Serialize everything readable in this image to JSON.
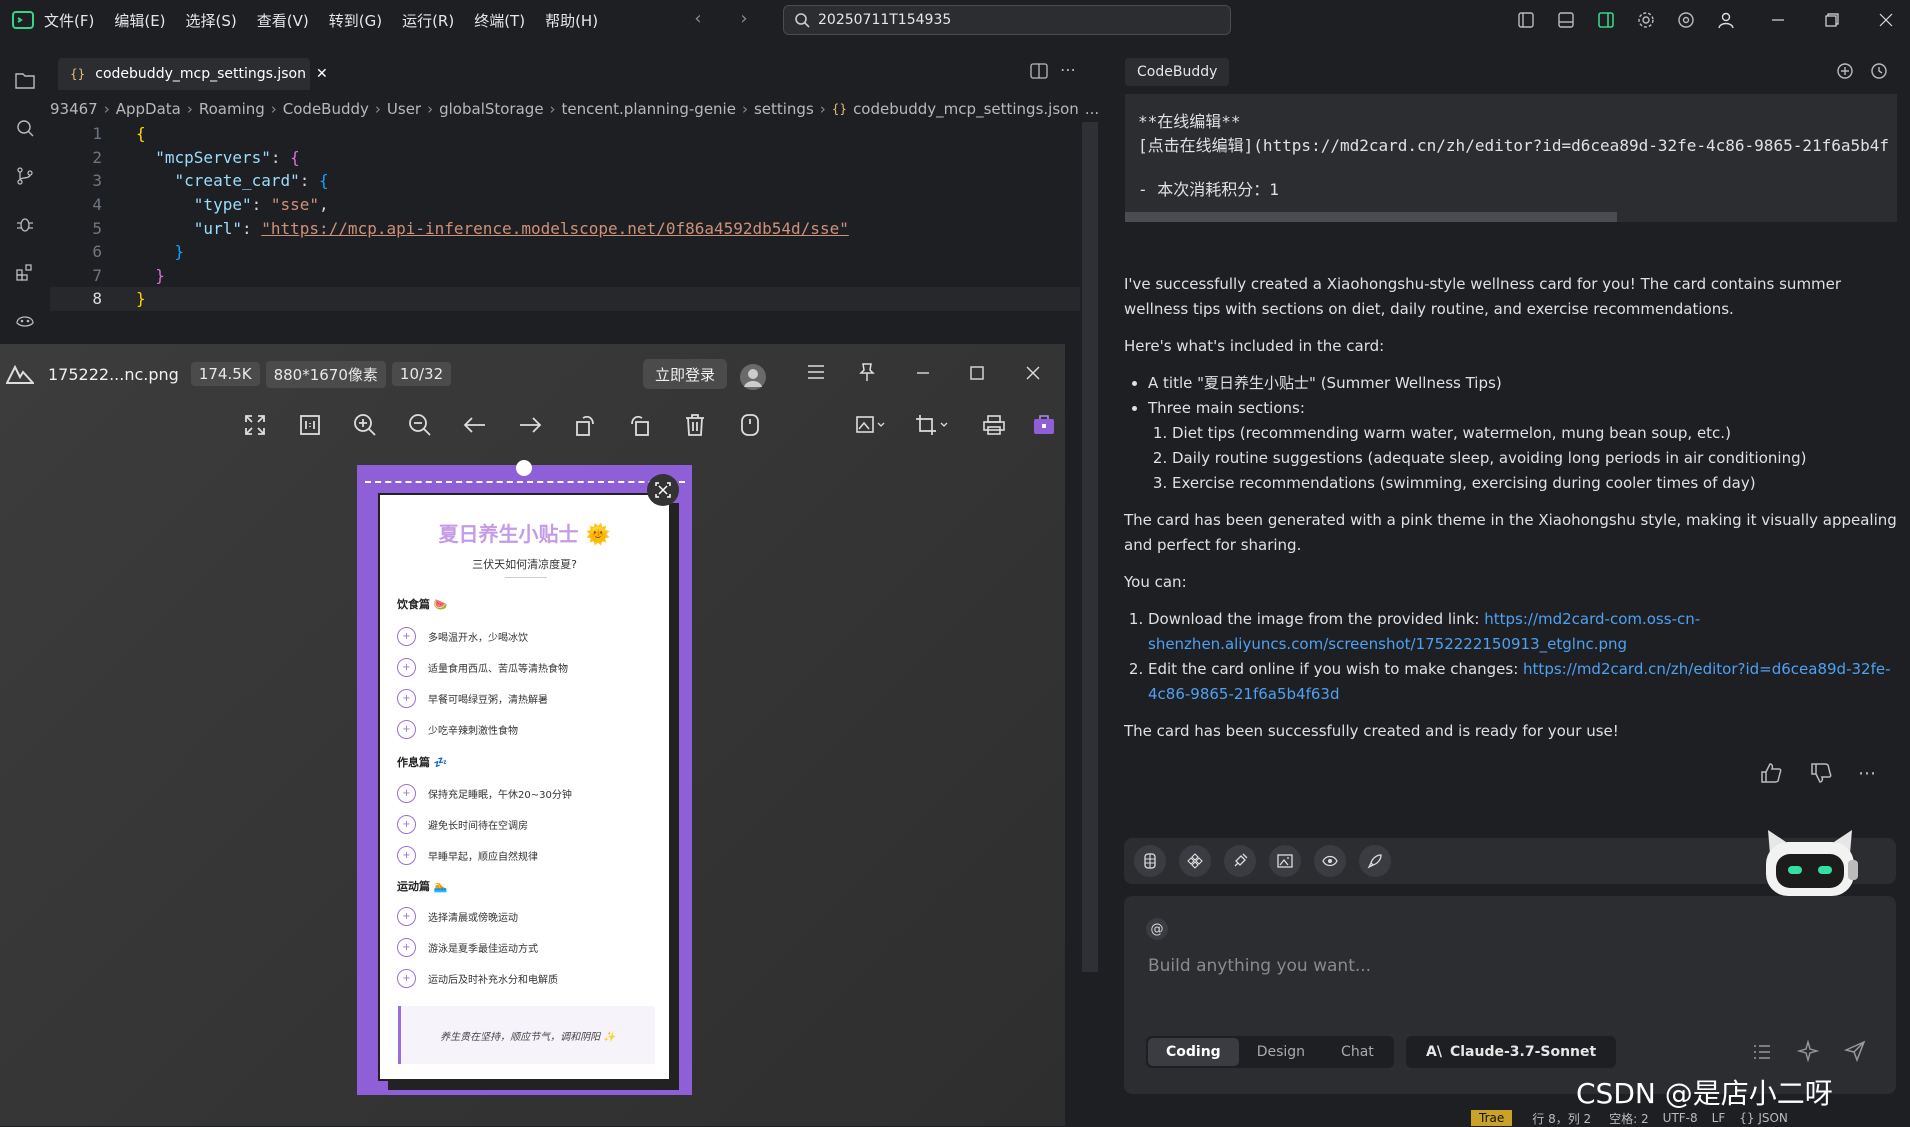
{
  "menu": [
    "文件(F)",
    "编辑(E)",
    "选择(S)",
    "查看(V)",
    "转到(G)",
    "运行(R)",
    "终端(T)",
    "帮助(H)"
  ],
  "search": {
    "value": "20250711T154935"
  },
  "editor": {
    "tab_label": "codebuddy_mcp_settings.json",
    "breadcrumb": [
      "93467",
      "AppData",
      "Roaming",
      "CodeBuddy",
      "User",
      "globalStorage",
      "tencent.planning-genie",
      "settings",
      "codebuddy_mcp_settings.json",
      "..."
    ],
    "lines": [
      "1",
      "2",
      "3",
      "4",
      "5",
      "6",
      "7",
      "8"
    ],
    "code": {
      "k1": "\"mcpServers\"",
      "k2": "\"create_card\"",
      "k3": "\"type\"",
      "v3": "\"sse\"",
      "k4": "\"url\"",
      "v4": "\"https://mcp.api-inference.modelscope.net/0f86a4592db54d/sse\""
    }
  },
  "viewer": {
    "filename": "175222...nc.png",
    "size": "174.5K",
    "dimensions": "880*1670像素",
    "index": "10/32",
    "login": "立即登录"
  },
  "card": {
    "title": "夏日养生小贴士 🌞",
    "subtitle": "三伏天如何清凉度夏?",
    "sections": [
      {
        "title": "饮食篇 🍉",
        "items": [
          "多喝温开水，少喝冰饮",
          "适量食用西瓜、苦瓜等清热食物",
          "早餐可喝绿豆粥，清热解暑",
          "少吃辛辣刺激性食物"
        ]
      },
      {
        "title": "作息篇 💤",
        "items": [
          "保持充足睡眠，午休20~30分钟",
          "避免长时间待在空调房",
          "早睡早起，顺应自然规律"
        ]
      },
      {
        "title": "运动篇 🏊",
        "items": [
          "选择清晨或傍晚运动",
          "游泳是夏季最佳运动方式",
          "运动后及时补充水分和电解质"
        ]
      }
    ],
    "quote": "养生贵在坚持，顺应节气，调和阴阳 ✨"
  },
  "panel": {
    "tab": "CodeBuddy",
    "code_lines": [
      "**在线编辑**",
      "[点击在线编辑](https://md2card.cn/zh/editor?id=d6cea89d-32fe-4c86-9865-21f6a5b4f",
      "",
      "- 本次消耗积分：1"
    ],
    "p1": "I've successfully created a Xiaohongshu-style wellness card for you! The card contains summer wellness tips with sections on diet, daily routine, and exercise recommendations.",
    "p2": "Here's what's included in the card:",
    "bullet1": "A title \"夏日养生小贴士\" (Summer Wellness Tips)",
    "bullet2": "Three main sections:",
    "sub": [
      "Diet tips (recommending warm water, watermelon, mung bean soup, etc.)",
      "Daily routine suggestions (adequate sleep, avoiding long periods in air conditioning)",
      "Exercise recommendations (swimming, exercising during cooler times of day)"
    ],
    "p3": "The card has been generated with a pink theme in the Xiaohongshu style, making it visually appealing and perfect for sharing.",
    "p4": "You can:",
    "o1_text": "Download the image from the provided link: ",
    "o1_link": "https://md2card-com.oss-cn-shenzhen.aliyuncs.com/screenshot/1752222150913_etglnc.png",
    "o2_text": "Edit the card online if you wish to make changes: ",
    "o2_link": "https://md2card.cn/zh/editor?id=d6cea89d-32fe-4c86-9865-21f6a5b4f63d",
    "p5": "The card has been successfully created and is ready for your use!",
    "input_at": "@",
    "input_placeholder": "Build anything you want...",
    "modes": [
      "Coding",
      "Design",
      "Chat"
    ],
    "model": "Claude-3.7-Sonnet"
  },
  "status": {
    "items": [
      "Trae",
      "行 8，列 2",
      "空格: 2",
      "UTF-8",
      "LF",
      "{} JSON"
    ]
  },
  "watermark": "CSDN @是店小二呀",
  "colors": {
    "accent": "#8e5fd6",
    "link": "#4ea1f3",
    "bg": "#1e1f22"
  }
}
